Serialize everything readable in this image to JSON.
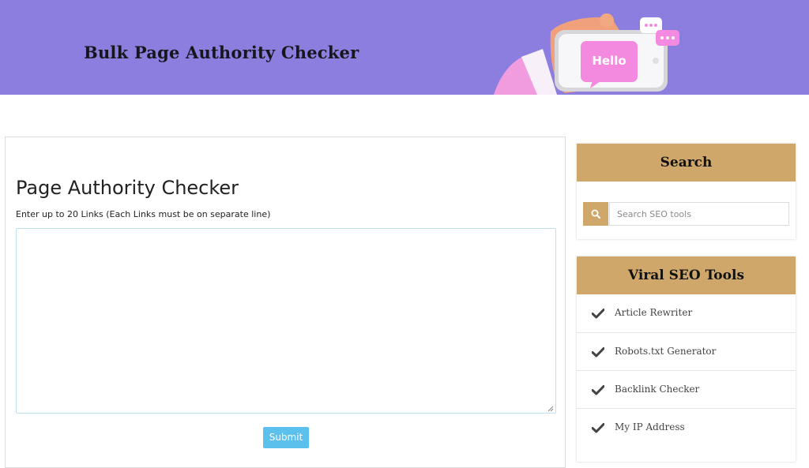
{
  "banner": {
    "title": "Bulk Page Authority Checker",
    "illustration_text": "Hello",
    "background_color": "#8c7edf"
  },
  "main": {
    "title": "Page Authority Checker",
    "links_label": "Enter up to 20 Links (Each Links must be on separate line)",
    "links_value": "",
    "submit_label": "Submit",
    "submit_color": "#5bc0eb"
  },
  "sidebar": {
    "accent_color": "#cfa76a",
    "search": {
      "title": "Search",
      "placeholder": "Search SEO tools",
      "icon": "search-icon"
    },
    "tools": {
      "title": "Viral SEO Tools",
      "icon": "check-icon",
      "items": [
        {
          "label": "Article Rewriter"
        },
        {
          "label": "Robots.txt Generator"
        },
        {
          "label": "Backlink Checker"
        },
        {
          "label": "My IP Address"
        }
      ]
    }
  }
}
